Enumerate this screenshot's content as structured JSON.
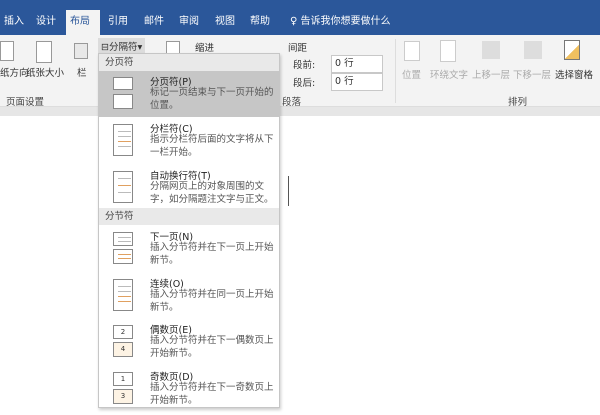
{
  "tabs": [
    {
      "label": "插入"
    },
    {
      "label": "设计"
    },
    {
      "label": "布局",
      "active": true
    },
    {
      "label": "引用"
    },
    {
      "label": "邮件"
    },
    {
      "label": "审阅"
    },
    {
      "label": "视图"
    },
    {
      "label": "帮助"
    }
  ],
  "tell_me": "告诉我你想要做什么",
  "ribbon": {
    "orientation": "纸方向",
    "size": "纸张大小",
    "columns": "栏",
    "breaks": "分隔符",
    "page_setup_group": "页面设置",
    "indent": "缩进",
    "spacing": "间距",
    "before_label": "段前:",
    "before_value": "0 行",
    "after_label": "段后:",
    "after_value": "0 行",
    "paragraph_group": "段落",
    "position": "位置",
    "wrap_text": "环绕文字",
    "bring_forward": "上移一层",
    "send_backward": "下移一层",
    "selection_pane": "选择窗格",
    "arrange_group": "排列"
  },
  "menu": {
    "page_breaks_header": "分页符",
    "section_breaks_header": "分节符",
    "page_items": [
      {
        "title": "分页符(P)",
        "desc": "标记一页结束与下一页开始的位置。",
        "icon": "page-break-icon",
        "highlighted": true
      },
      {
        "title": "分栏符(C)",
        "desc": "指示分栏符后面的文字将从下一栏开始。",
        "icon": "column-break-icon"
      },
      {
        "title": "自动换行符(T)",
        "desc": "分隔网页上的对象周围的文字，如分隔题注文字与正文。",
        "icon": "text-wrapping-break-icon"
      }
    ],
    "section_items": [
      {
        "title": "下一页(N)",
        "desc": "插入分节符并在下一页上开始新节。",
        "icon": "next-page-icon"
      },
      {
        "title": "连续(O)",
        "desc": "插入分节符并在同一页上开始新节。",
        "icon": "continuous-icon"
      },
      {
        "title": "偶数页(E)",
        "desc": "插入分节符并在下一偶数页上开始新节。",
        "icon": "even-page-icon",
        "num_top": "2",
        "num_bottom": "4"
      },
      {
        "title": "奇数页(D)",
        "desc": "插入分节符并在下一奇数页上开始新节。",
        "icon": "odd-page-icon",
        "num_top": "1",
        "num_bottom": "3"
      }
    ]
  },
  "colors": {
    "title_bar": "#2b579a",
    "ribbon": "#f3f3f3",
    "highlight": "#c6c6c6"
  }
}
